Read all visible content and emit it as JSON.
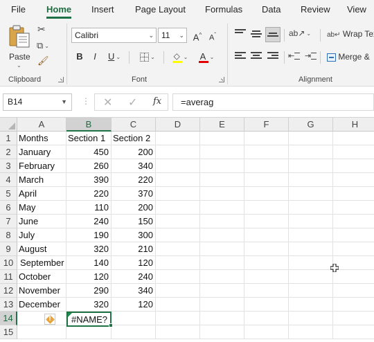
{
  "ribbon_tabs": [
    "File",
    "Home",
    "Insert",
    "Page Layout",
    "Formulas",
    "Data",
    "Review",
    "View"
  ],
  "active_tab": "Home",
  "clipboard": {
    "paste_label": "Paste",
    "group_label": "Clipboard"
  },
  "font": {
    "name": "Calibri",
    "size": "11",
    "bold": "B",
    "italic": "I",
    "underline": "U",
    "font_color_letter": "A",
    "grow": "A",
    "shrink": "A",
    "group_label": "Font"
  },
  "alignment": {
    "wrap_text": "Wrap Tex",
    "merge": "Merge &",
    "group_label": "Alignment"
  },
  "formula_bar": {
    "name_box": "B14",
    "formula": "=averag",
    "fx": "fx"
  },
  "sheet": {
    "columns": [
      "A",
      "B",
      "C",
      "D",
      "E",
      "F",
      "G",
      "H"
    ],
    "selected_column": "B",
    "rows": [
      "1",
      "2",
      "3",
      "4",
      "5",
      "6",
      "7",
      "8",
      "9",
      "10",
      "11",
      "12",
      "13",
      "14",
      "15"
    ],
    "selected_row": "14",
    "headers": [
      "Months",
      "Section 1",
      "Section 2"
    ],
    "data": [
      {
        "month": "January",
        "s1": "450",
        "s2": "200"
      },
      {
        "month": "February",
        "s1": "260",
        "s2": "340"
      },
      {
        "month": "March",
        "s1": "390",
        "s2": "220"
      },
      {
        "month": "April",
        "s1": "220",
        "s2": "370"
      },
      {
        "month": "May",
        "s1": "110",
        "s2": "200"
      },
      {
        "month": "June",
        "s1": "240",
        "s2": "150"
      },
      {
        "month": "July",
        "s1": "190",
        "s2": "300"
      },
      {
        "month": "August",
        "s1": "320",
        "s2": "210"
      },
      {
        "month": "September",
        "s1": "140",
        "s2": "120"
      },
      {
        "month": "October",
        "s1": "120",
        "s2": "240"
      },
      {
        "month": "November",
        "s1": "290",
        "s2": "340"
      },
      {
        "month": "December",
        "s1": "320",
        "s2": "120"
      }
    ],
    "active_cell_value": "#NAME?",
    "warning_symbol": "!"
  },
  "colors": {
    "accent": "#217346",
    "error_warning": "#e8a33a",
    "highlight_yellow": "#ffff00",
    "font_red": "#e00000"
  }
}
